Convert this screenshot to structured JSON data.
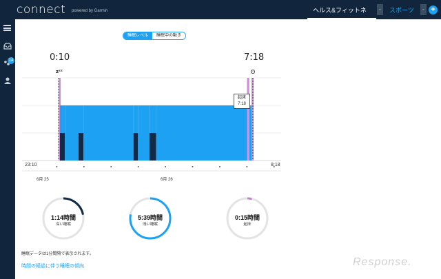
{
  "app": {
    "logo": "connect",
    "powered_by": "powered by Garmin"
  },
  "nav": {
    "health_fitness": "ヘルス&フィットネス",
    "sports": "スポーツ",
    "caret": "-",
    "plus": "+"
  },
  "sidebar": {
    "badge_count": "14",
    "icons": [
      "menu-icon",
      "inbox-icon",
      "connections-icon",
      "profile-icon"
    ]
  },
  "toggle": {
    "active": "睡眠レベル",
    "inactive": "睡眠中の動き"
  },
  "times": {
    "start": "0:10",
    "end": "7:18"
  },
  "tooltip": {
    "label": "起床",
    "time": "7:18"
  },
  "axis": {
    "left_time": "23:10",
    "right_time": "8:18",
    "date1": "6月 25",
    "date2": "6月 26"
  },
  "rings": [
    {
      "value": "1:14時間",
      "label": "深い睡眠",
      "fraction": 0.22
    },
    {
      "value": "5:39時間",
      "label": "浅い睡眠",
      "fraction": 0.78
    },
    {
      "value": "0:15時間",
      "label": "起床",
      "fraction": 0.035
    }
  ],
  "note": "睡眠データは1分間隔で表示されます。",
  "trend_link": "時間の経過に伴う睡眠の傾向",
  "watermark": "Response.",
  "colors": {
    "light": "#1da1f2",
    "deep": "#0f2b48",
    "awake": "#c77bd6",
    "ring_track": "#e3e3e3",
    "nav_bg": "#11263c"
  },
  "chart_data": {
    "type": "bar",
    "title": "",
    "levels": [
      "deep",
      "light",
      "awake"
    ],
    "x_range": [
      "23:10",
      "8:18"
    ],
    "sleep_start": "0:10",
    "sleep_end": "7:18",
    "segments": [
      {
        "start": "0:10",
        "end": "0:13",
        "level": "awake"
      },
      {
        "start": "0:13",
        "end": "0:24",
        "level": "deep"
      },
      {
        "start": "0:24",
        "end": "0:54",
        "level": "light"
      },
      {
        "start": "0:54",
        "end": "1:05",
        "level": "deep"
      },
      {
        "start": "1:05",
        "end": "2:55",
        "level": "light"
      },
      {
        "start": "2:55",
        "end": "3:05",
        "level": "deep"
      },
      {
        "start": "3:05",
        "end": "3:30",
        "level": "light"
      },
      {
        "start": "3:30",
        "end": "3:45",
        "level": "deep"
      },
      {
        "start": "3:45",
        "end": "7:05",
        "level": "light"
      },
      {
        "start": "7:05",
        "end": "7:10",
        "level": "awake"
      },
      {
        "start": "7:10",
        "end": "7:15",
        "level": "light"
      },
      {
        "start": "7:15",
        "end": "7:18",
        "level": "awake"
      }
    ]
  }
}
